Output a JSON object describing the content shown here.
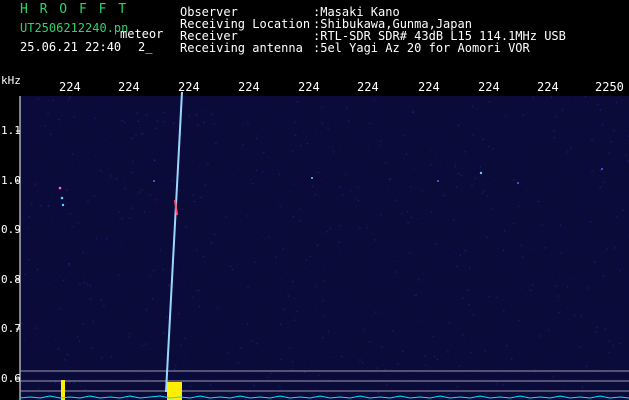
{
  "header": {
    "title": "H R O F F T",
    "filename": "UT2506212240.pn",
    "tag": "meteor",
    "datetime": "25.06.21 22:40",
    "index": "2_",
    "info_labels": [
      "Observer",
      "Receiving Location",
      "Receiver",
      "Receiving antenna"
    ],
    "info_values": [
      ":Masaki Kano",
      ":Shibukawa,Gunma,Japan",
      ":RTL-SDR SDR# 43dB L15 114.1MHz USB",
      ":5el Yagi Az 20 for Aomori VOR"
    ]
  },
  "axes": {
    "y_unit": "kHz",
    "y_ticks": [
      "1.1",
      "1.0",
      "0.9",
      "0.8",
      "0.7",
      "0.6"
    ],
    "x_ticks": [
      "224",
      "224",
      "224",
      "224",
      "224",
      "224",
      "224",
      "224",
      "224",
      "2250"
    ]
  },
  "colors": {
    "background": "#0b0b3a",
    "header_green": "#2fd36a",
    "trail": "#9ad7ff",
    "marker_yellow": "#ffee00",
    "noise_cyan": "#00e5ff"
  }
}
